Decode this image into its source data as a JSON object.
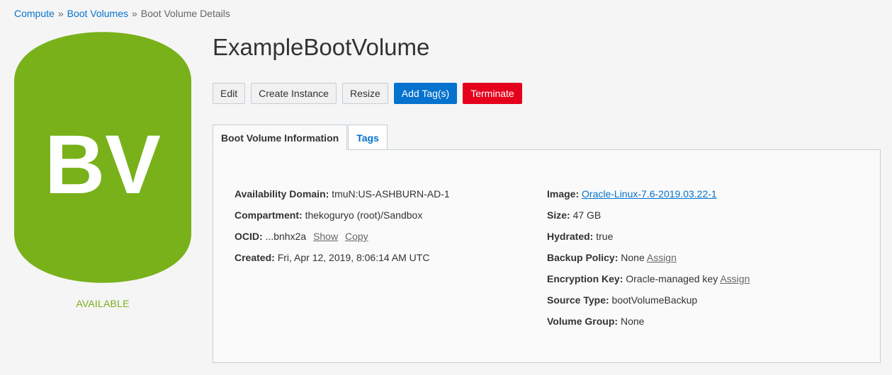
{
  "breadcrumb": {
    "items": [
      "Compute",
      "Boot Volumes"
    ],
    "separator": "»",
    "current": "Boot Volume Details"
  },
  "resource_icon": {
    "text": "BV",
    "color": "#78b11a",
    "icon": "database-cylinder-icon"
  },
  "status": {
    "label": "AVAILABLE",
    "color": "#78b11a"
  },
  "title": "ExampleBootVolume",
  "actions": {
    "edit": "Edit",
    "create_instance": "Create Instance",
    "resize": "Resize",
    "add_tags": "Add Tag(s)",
    "terminate": "Terminate"
  },
  "tabs": {
    "info": "Boot Volume Information",
    "tags": "Tags"
  },
  "details_left": {
    "availability_domain": {
      "label": "Availability Domain:",
      "value": "tmuN:US-ASHBURN-AD-1"
    },
    "compartment": {
      "label": "Compartment:",
      "value": "thekoguryo (root)/Sandbox"
    },
    "ocid": {
      "label": "OCID:",
      "value": "...bnhx2a",
      "show": "Show",
      "copy": "Copy"
    },
    "created": {
      "label": "Created:",
      "value": "Fri, Apr 12, 2019, 8:06:14 AM UTC"
    }
  },
  "details_right": {
    "image": {
      "label": "Image:",
      "value": "Oracle-Linux-7.6-2019.03.22-1"
    },
    "size": {
      "label": "Size:",
      "value": "47 GB"
    },
    "hydrated": {
      "label": "Hydrated:",
      "value": "true"
    },
    "backup_policy": {
      "label": "Backup Policy:",
      "value": "None",
      "action": "Assign"
    },
    "encryption_key": {
      "label": "Encryption Key:",
      "value": "Oracle-managed key",
      "action": "Assign"
    },
    "source_type": {
      "label": "Source Type:",
      "value": "bootVolumeBackup"
    },
    "volume_group": {
      "label": "Volume Group:",
      "value": "None"
    }
  }
}
